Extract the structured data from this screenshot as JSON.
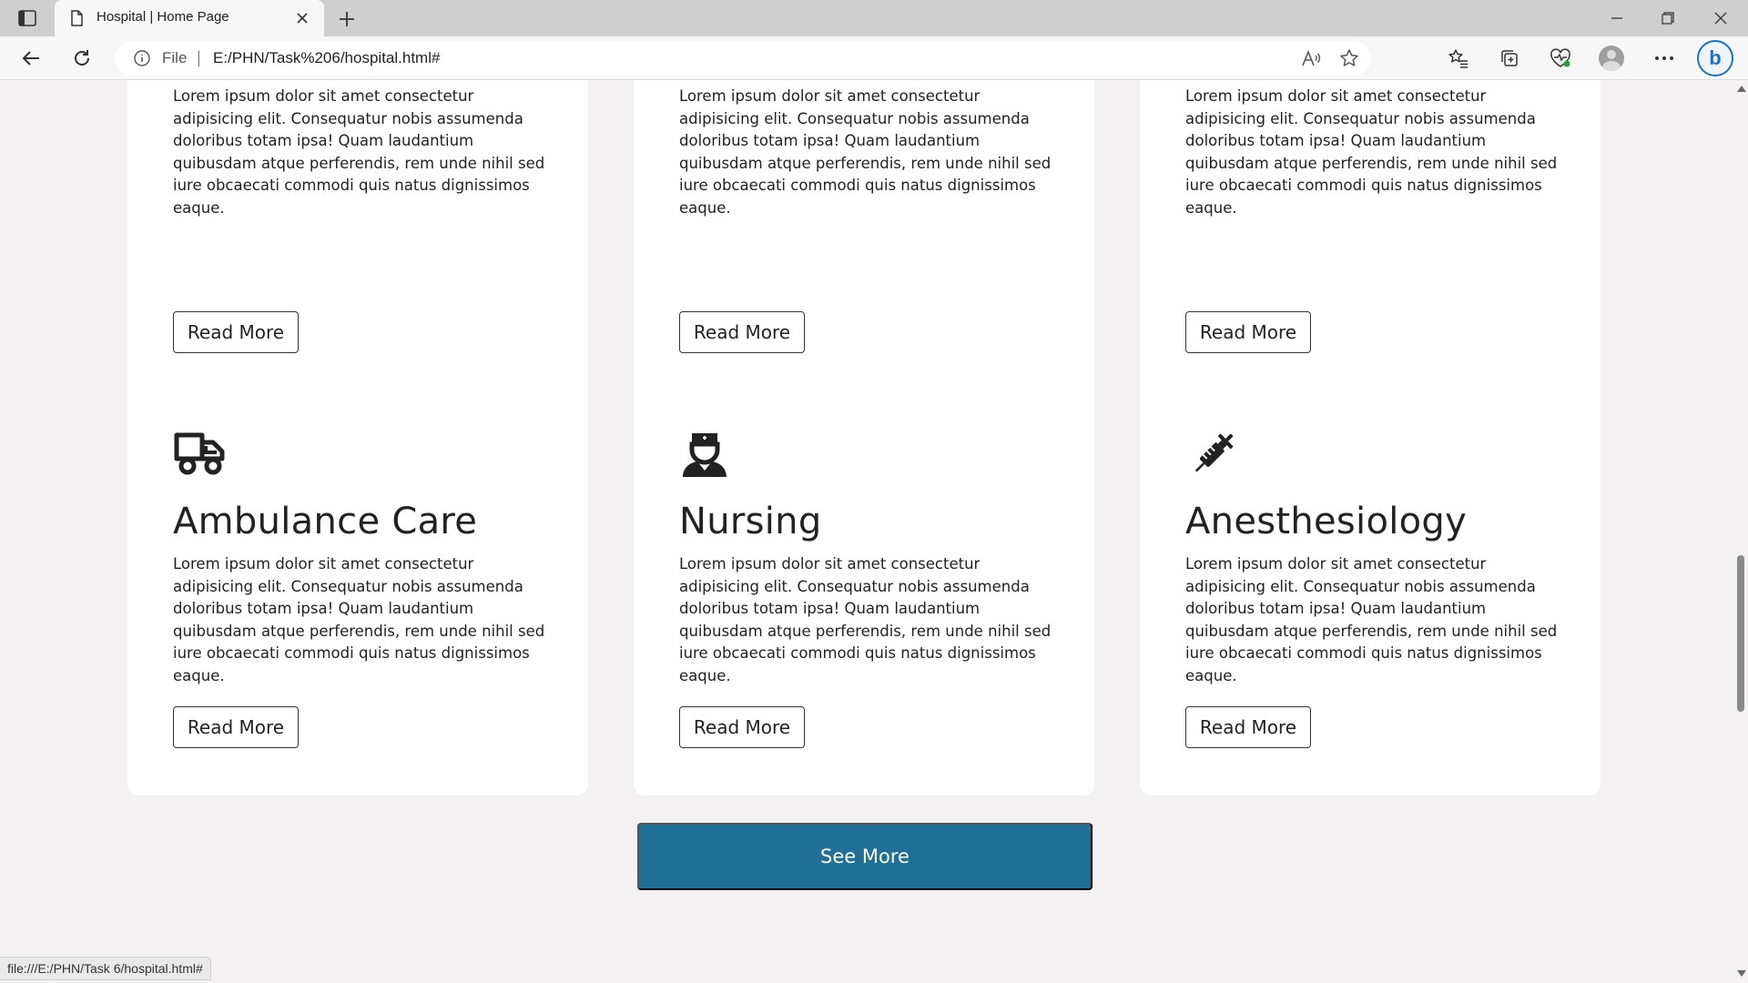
{
  "browser": {
    "tab_title": "Hospital | Home Page",
    "address_scheme": "File",
    "address_url": "E:/PHN/Task%206/hospital.html#",
    "status_url": "file:///E:/PHN/Task 6/hospital.html#"
  },
  "top_cards": [
    {
      "text": "Lorem ipsum dolor sit amet consectetur adipisicing elit. Consequatur nobis assumenda doloribus totam ipsa! Quam laudantium quibusdam atque perferendis, rem unde nihil sed iure obcaecati commodi quis natus dignissimos eaque.",
      "button": "Read More"
    },
    {
      "text": "Lorem ipsum dolor sit amet consectetur adipisicing elit. Consequatur nobis assumenda doloribus totam ipsa! Quam laudantium quibusdam atque perferendis, rem unde nihil sed iure obcaecati commodi quis natus dignissimos eaque.",
      "button": "Read More"
    },
    {
      "text": "Lorem ipsum dolor sit amet consectetur adipisicing elit. Consequatur nobis assumenda doloribus totam ipsa! Quam laudantium quibusdam atque perferendis, rem unde nihil sed iure obcaecati commodi quis natus dignissimos eaque.",
      "button": "Read More"
    }
  ],
  "services": [
    {
      "icon": "ambulance-icon",
      "title": "Ambulance Care",
      "text": "Lorem ipsum dolor sit amet consectetur adipisicing elit. Consequatur nobis assumenda doloribus totam ipsa! Quam laudantium quibusdam atque perferendis, rem unde nihil sed iure obcaecati commodi quis natus dignissimos eaque.",
      "button": "Read More"
    },
    {
      "icon": "nurse-icon",
      "title": "Nursing",
      "text": "Lorem ipsum dolor sit amet consectetur adipisicing elit. Consequatur nobis assumenda doloribus totam ipsa! Quam laudantium quibusdam atque perferendis, rem unde nihil sed iure obcaecati commodi quis natus dignissimos eaque.",
      "button": "Read More"
    },
    {
      "icon": "syringe-icon",
      "title": "Anesthesiology",
      "text": "Lorem ipsum dolor sit amet consectetur adipisicing elit. Consequatur nobis assumenda doloribus totam ipsa! Quam laudantium quibusdam atque perferendis, rem unde nihil sed iure obcaecati commodi quis natus dignissimos eaque.",
      "button": "Read More"
    }
  ],
  "see_more": "See More",
  "colors": {
    "page_background": "#f3f1f1",
    "card_background": "#ffffff",
    "accent": "#1f6f96",
    "text": "#222222"
  }
}
